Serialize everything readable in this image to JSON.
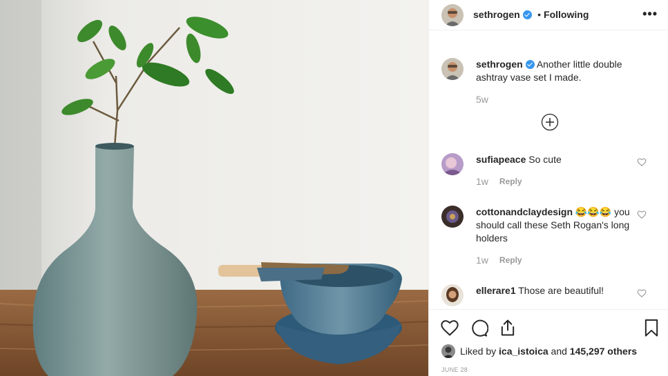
{
  "post_header": {
    "username": "sethrogen",
    "separator": "•",
    "follow_status": "Following",
    "more_label": "•••"
  },
  "caption": {
    "username": "sethrogen",
    "text": "Another little double ashtray vase set I made.",
    "age": "5w"
  },
  "comments": [
    {
      "username": "sufiapeace",
      "text": "So cute",
      "age": "1w",
      "reply_label": "Reply"
    },
    {
      "username": "cottonandclaydesign",
      "text": "😂😂😂 you should call these Seth Rogan's long holders",
      "age": "1w",
      "reply_label": "Reply"
    },
    {
      "username": "ellerare1",
      "text": "Those are beautiful!"
    }
  ],
  "likes": {
    "prefix": "Liked by",
    "user": "ica_istoica",
    "suffix": "and",
    "count": "145,297 others"
  },
  "post_date": "JUNE 28",
  "icons": {
    "header_verified": "verified-badge-icon",
    "load_more": "plus-circle-icon",
    "like": "heart-icon",
    "comment": "comment-bubble-icon",
    "share": "share-icon",
    "save": "bookmark-icon"
  },
  "colors": {
    "verified": "#3897f0",
    "text": "#262626",
    "muted": "#999999",
    "border": "#efefef"
  }
}
